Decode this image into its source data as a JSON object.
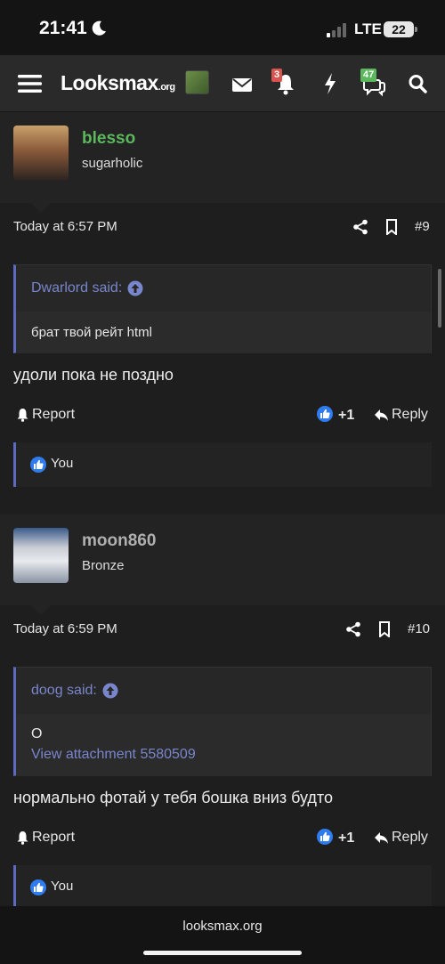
{
  "status": {
    "time": "21:41",
    "network": "LTE",
    "battery": "22"
  },
  "nav": {
    "logo_main": "Looksmax",
    "logo_suffix": ".org",
    "alerts_count": "3",
    "conversations_count": "47"
  },
  "posts": [
    {
      "username": "blesso",
      "user_title": "sugarholic",
      "date": "Today at 6:57 PM",
      "post_number": "#9",
      "quote_author": "Dwarlord said:",
      "quote_text": "брат твой рейт html",
      "message": "удоли пока не поздно",
      "report_label": "Report",
      "reaction_score": "+1",
      "reply_label": "Reply",
      "liked_by": "You",
      "username_color": "#5cb85c"
    },
    {
      "username": "moon860",
      "user_title": "Bronze",
      "date": "Today at 6:59 PM",
      "post_number": "#10",
      "quote_author": "doog said:",
      "quote_text": "O",
      "quote_link": "View attachment 5580509",
      "message": "нормально фотай у тебя бошка вниз будто",
      "report_label": "Report",
      "reaction_score": "+1",
      "reply_label": "Reply",
      "liked_by": "You",
      "username_color": "#b0b0b0"
    }
  ],
  "browser": {
    "url": "looksmax.org"
  }
}
